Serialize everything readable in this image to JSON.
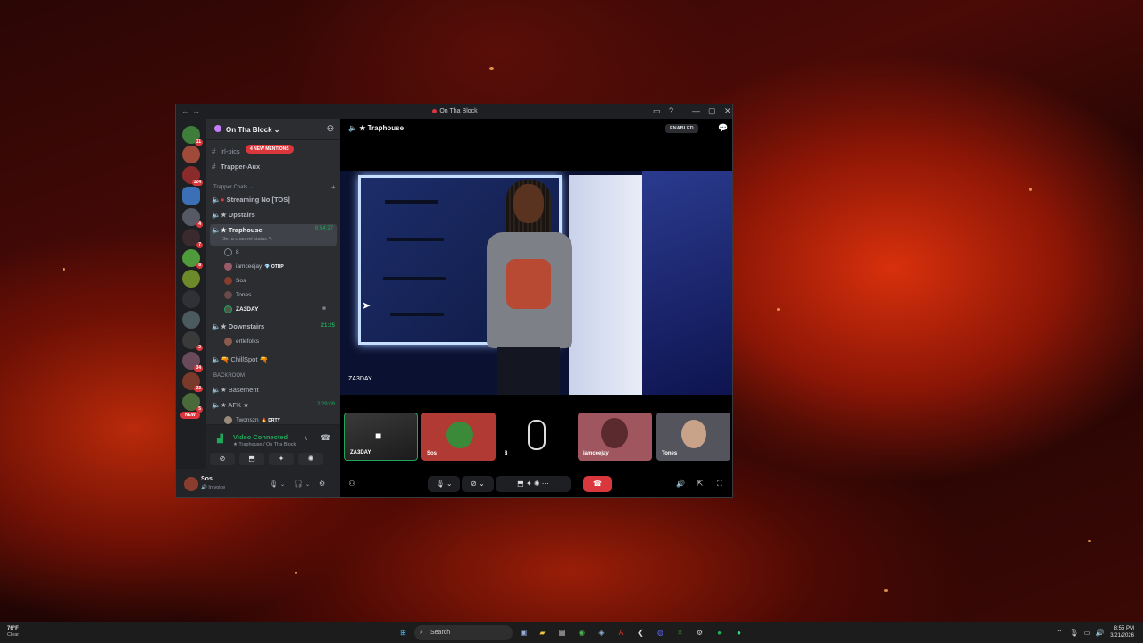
{
  "window": {
    "title": "On Tha Block",
    "nav_back": "←",
    "nav_forward": "→",
    "ctl_inbox": "▭",
    "ctl_help": "?",
    "ctl_min": "—",
    "ctl_max": "▢",
    "ctl_close": "✕"
  },
  "servers": {
    "badges": [
      "11",
      "",
      "124",
      "",
      "4",
      "7",
      "8",
      "",
      "",
      "",
      "2",
      "34",
      "23",
      "5"
    ],
    "new_label": "NEW"
  },
  "guild": {
    "name": "On Tha Block ⌄",
    "add": "⚇"
  },
  "mentions": "4 NEW MENTIONS",
  "channels": {
    "irl_pics": "irl-pics",
    "trapper_aux": "Trapper-Aux",
    "category": "Trapper Chats ⌄",
    "category_add": "+",
    "streaming": "Streaming No  [TOS]",
    "upstairs": "★ Upstairs",
    "traphouse": "★ Traphouse",
    "traphouse_time": "6:54:27",
    "traphouse_status": "Set a channel status ✎",
    "downstairs": "★ Downstairs",
    "downstairs_time": "21:25",
    "chillspot": "🔫 ChillSpot 🔫",
    "backroom": "BACKROOM",
    "basement": "★ Basement",
    "afk": "★ AFK ★",
    "afk_time": "2:29:09"
  },
  "users": {
    "traphouse": [
      {
        "name": "8",
        "tag": ""
      },
      {
        "name": "iamceejay",
        "tag": "💎 OTRP"
      },
      {
        "name": "Sos",
        "tag": ""
      },
      {
        "name": "Tones",
        "tag": ""
      },
      {
        "name": "ZA3DAY",
        "tag": ""
      }
    ],
    "downstairs": [
      {
        "name": "ertlefolks",
        "tag": ""
      }
    ],
    "afk": [
      {
        "name": "Twonszn",
        "tag": "🔥 DRTY"
      }
    ]
  },
  "voice_connection": {
    "status": "Video Connected",
    "channel": "★ Traphouse / On Tha Block"
  },
  "user_panel": {
    "name": "Sos",
    "status": "🔊 In voice"
  },
  "stage": {
    "header": "★ Traphouse",
    "enabled_badge": "ENABLED",
    "main_video_label": "ZA3DAY",
    "tiles": [
      {
        "label": "ZA3DAY",
        "active": true
      },
      {
        "label": "Sos",
        "active": false
      },
      {
        "label": "8",
        "active": false
      },
      {
        "label": "iamceejay",
        "active": false
      },
      {
        "label": "Tones",
        "active": false
      }
    ]
  },
  "taskbar": {
    "temp": "76°F",
    "weather": "Clear",
    "search": "Search",
    "time": "8:55 PM",
    "date": "3/21/2026"
  },
  "colors": {
    "accent_green": "#23a559",
    "danger_red": "#da373c",
    "sidebar": "#2b2d31",
    "rail": "#1e1f22"
  }
}
